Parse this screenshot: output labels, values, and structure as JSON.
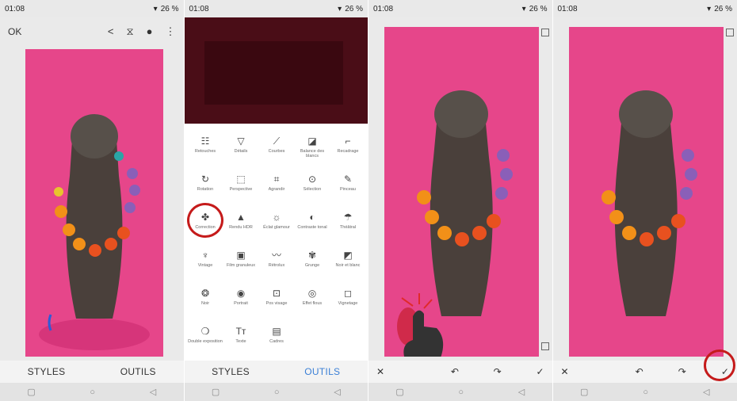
{
  "status": {
    "time": "01:08",
    "battery": "26 %"
  },
  "screen1": {
    "ok": "OK",
    "styles": "STYLES",
    "outils": "OUTILS"
  },
  "screen2": {
    "styles": "STYLES",
    "outils": "OUTILS",
    "tools": [
      {
        "icon": "☷",
        "label": "Retouches"
      },
      {
        "icon": "▽",
        "label": "Détails"
      },
      {
        "icon": "⟋",
        "label": "Courbes"
      },
      {
        "icon": "◪",
        "label": "Balance des blancs"
      },
      {
        "icon": "⌐",
        "label": "Recadrage"
      },
      {
        "icon": "↻",
        "label": "Rotation"
      },
      {
        "icon": "⬚",
        "label": "Perspective"
      },
      {
        "icon": "⌗",
        "label": "Agrandir"
      },
      {
        "icon": "⊙",
        "label": "Sélection"
      },
      {
        "icon": "✎",
        "label": "Pinceau"
      },
      {
        "icon": "✤",
        "label": "Correction"
      },
      {
        "icon": "▲",
        "label": "Rendu HDR"
      },
      {
        "icon": "☼",
        "label": "Éclat glamour"
      },
      {
        "icon": "◐",
        "label": "Contraste tonal"
      },
      {
        "icon": "☂",
        "label": "Théâtral"
      },
      {
        "icon": "♆",
        "label": "Vintage"
      },
      {
        "icon": "▣",
        "label": "Film granuleux"
      },
      {
        "icon": "〰",
        "label": "Rétrolux"
      },
      {
        "icon": "✾",
        "label": "Grunge"
      },
      {
        "icon": "◩",
        "label": "Noir et blanc"
      },
      {
        "icon": "❂",
        "label": "Noir"
      },
      {
        "icon": "◉",
        "label": "Portrait"
      },
      {
        "icon": "⊡",
        "label": "Pos visage"
      },
      {
        "icon": "◎",
        "label": "Effet flous"
      },
      {
        "icon": "◻",
        "label": "Vignetage"
      },
      {
        "icon": "❍",
        "label": "Double exposition"
      },
      {
        "icon": "Tт",
        "label": "Texte"
      },
      {
        "icon": "▤",
        "label": "Cadres"
      }
    ]
  },
  "editbar": {
    "close": "✕",
    "undo": "↶",
    "redo": "↷",
    "check": "✓"
  },
  "nav": {
    "square": "▢",
    "circle": "○",
    "back": "◁"
  }
}
